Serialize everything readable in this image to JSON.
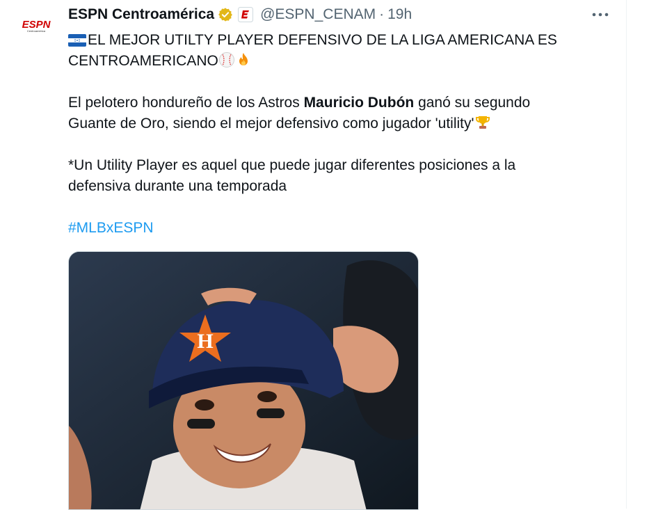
{
  "account": {
    "display_name": "ESPN Centroamérica",
    "handle": "@ESPN_CENAM",
    "separator": "·",
    "time": "19h",
    "avatar_text": "ESPN",
    "avatar_subtext": "Centroamérica"
  },
  "tweet": {
    "line1": "EL MEJOR UTILTY PLAYER DEFENSIVO DE LA LIGA AMERICANA ES",
    "line2": "CENTROAMERICANO",
    "p2_a": "El pelotero hondureño de los Astros ",
    "p2_bold": "Mauricio Dubón",
    "p2_b": " ganó su segundo",
    "p2_line2": "Guante de Oro, siendo el mejor defensivo como jugador 'utility'",
    "p3_line1": "*Un Utility Player es aquel que puede jugar diferentes posiciones a la",
    "p3_line2": "defensiva durante una temporada",
    "hashtag": "#MLBxESPN"
  },
  "icons": {
    "verified": "verified-badge-icon",
    "affiliate": "espn-affiliate-icon",
    "more": "more-options-icon",
    "flag": "honduras-flag-icon",
    "baseball": "baseball-icon",
    "fire": "fire-icon",
    "trophy": "trophy-icon"
  },
  "colors": {
    "text": "#0f1419",
    "secondary": "#536471",
    "link": "#1d9bf0",
    "verified_gold": "#e2b719",
    "espn_red": "#d00000"
  }
}
